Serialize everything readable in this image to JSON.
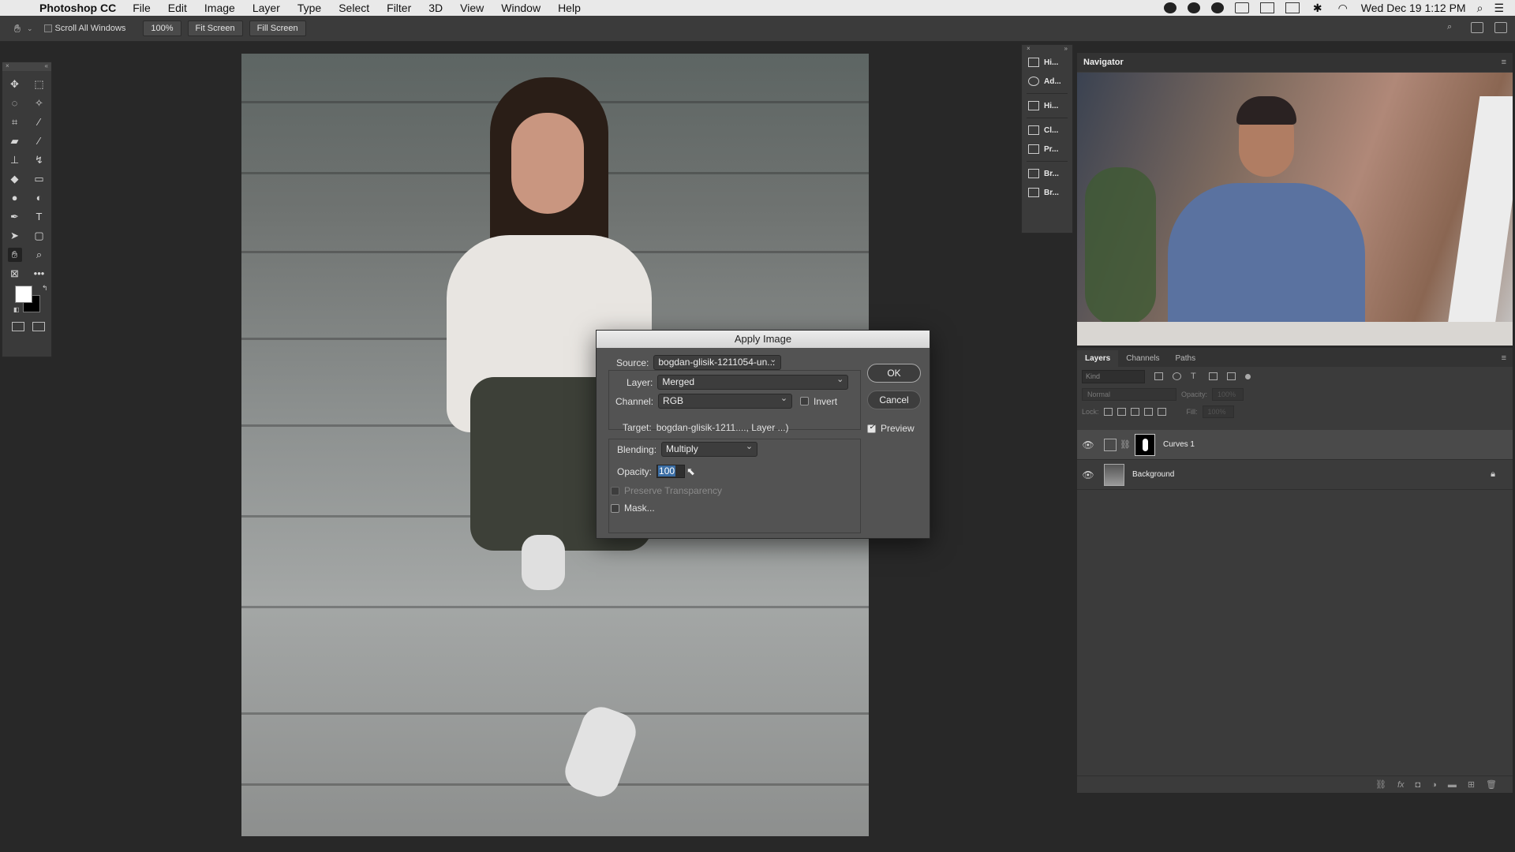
{
  "menubar": {
    "app_name": "Photoshop CC",
    "menus": [
      "File",
      "Edit",
      "Image",
      "Layer",
      "Type",
      "Select",
      "Filter",
      "3D",
      "View",
      "Window",
      "Help"
    ],
    "clock": "Wed Dec 19  1:12 PM"
  },
  "options_bar": {
    "scroll_all_windows": "Scroll All Windows",
    "zoom": "100%",
    "fit_screen": "Fit Screen",
    "fill_screen": "Fill Screen"
  },
  "toolbox": {
    "tools": [
      "move",
      "marquee",
      "lasso",
      "magic-wand",
      "crop",
      "eyedropper",
      "healing",
      "brush",
      "stamp",
      "history-brush",
      "eraser",
      "gradient",
      "blur",
      "dodge",
      "pen",
      "type",
      "path-select",
      "shape",
      "hand",
      "zoom",
      "frame",
      "more"
    ],
    "foreground_color": "#ffffff",
    "background_color": "#000000"
  },
  "apply_image": {
    "title": "Apply Image",
    "source_label": "Source:",
    "source_value": "bogdan-glisik-1211054-un...",
    "layer_label": "Layer:",
    "layer_value": "Merged",
    "channel_label": "Channel:",
    "channel_value": "RGB",
    "invert_label": "Invert",
    "target_label": "Target:",
    "target_value": "bogdan-glisik-1211...., Layer ...)",
    "blending_label": "Blending:",
    "blending_value": "Multiply",
    "opacity_label": "Opacity:",
    "opacity_value": "100",
    "preserve_transparency": "Preserve Transparency",
    "mask_label": "Mask...",
    "ok": "OK",
    "cancel": "Cancel",
    "preview": "Preview"
  },
  "panel_strip": {
    "items": [
      "Hi...",
      "Ad...",
      "Hi...",
      "Cl...",
      "Pr...",
      "Br...",
      "Br..."
    ]
  },
  "navigator": {
    "title": "Navigator"
  },
  "layers_panel": {
    "tabs": [
      "Layers",
      "Channels",
      "Paths"
    ],
    "kind_label": "Kind",
    "blend_mode": "Normal",
    "opacity_label": "Opacity:",
    "opacity_value": "100%",
    "lock_label": "Lock:",
    "fill_label": "Fill:",
    "fill_value": "100%",
    "layers": [
      {
        "name": "Curves 1"
      },
      {
        "name": "Background"
      }
    ]
  }
}
